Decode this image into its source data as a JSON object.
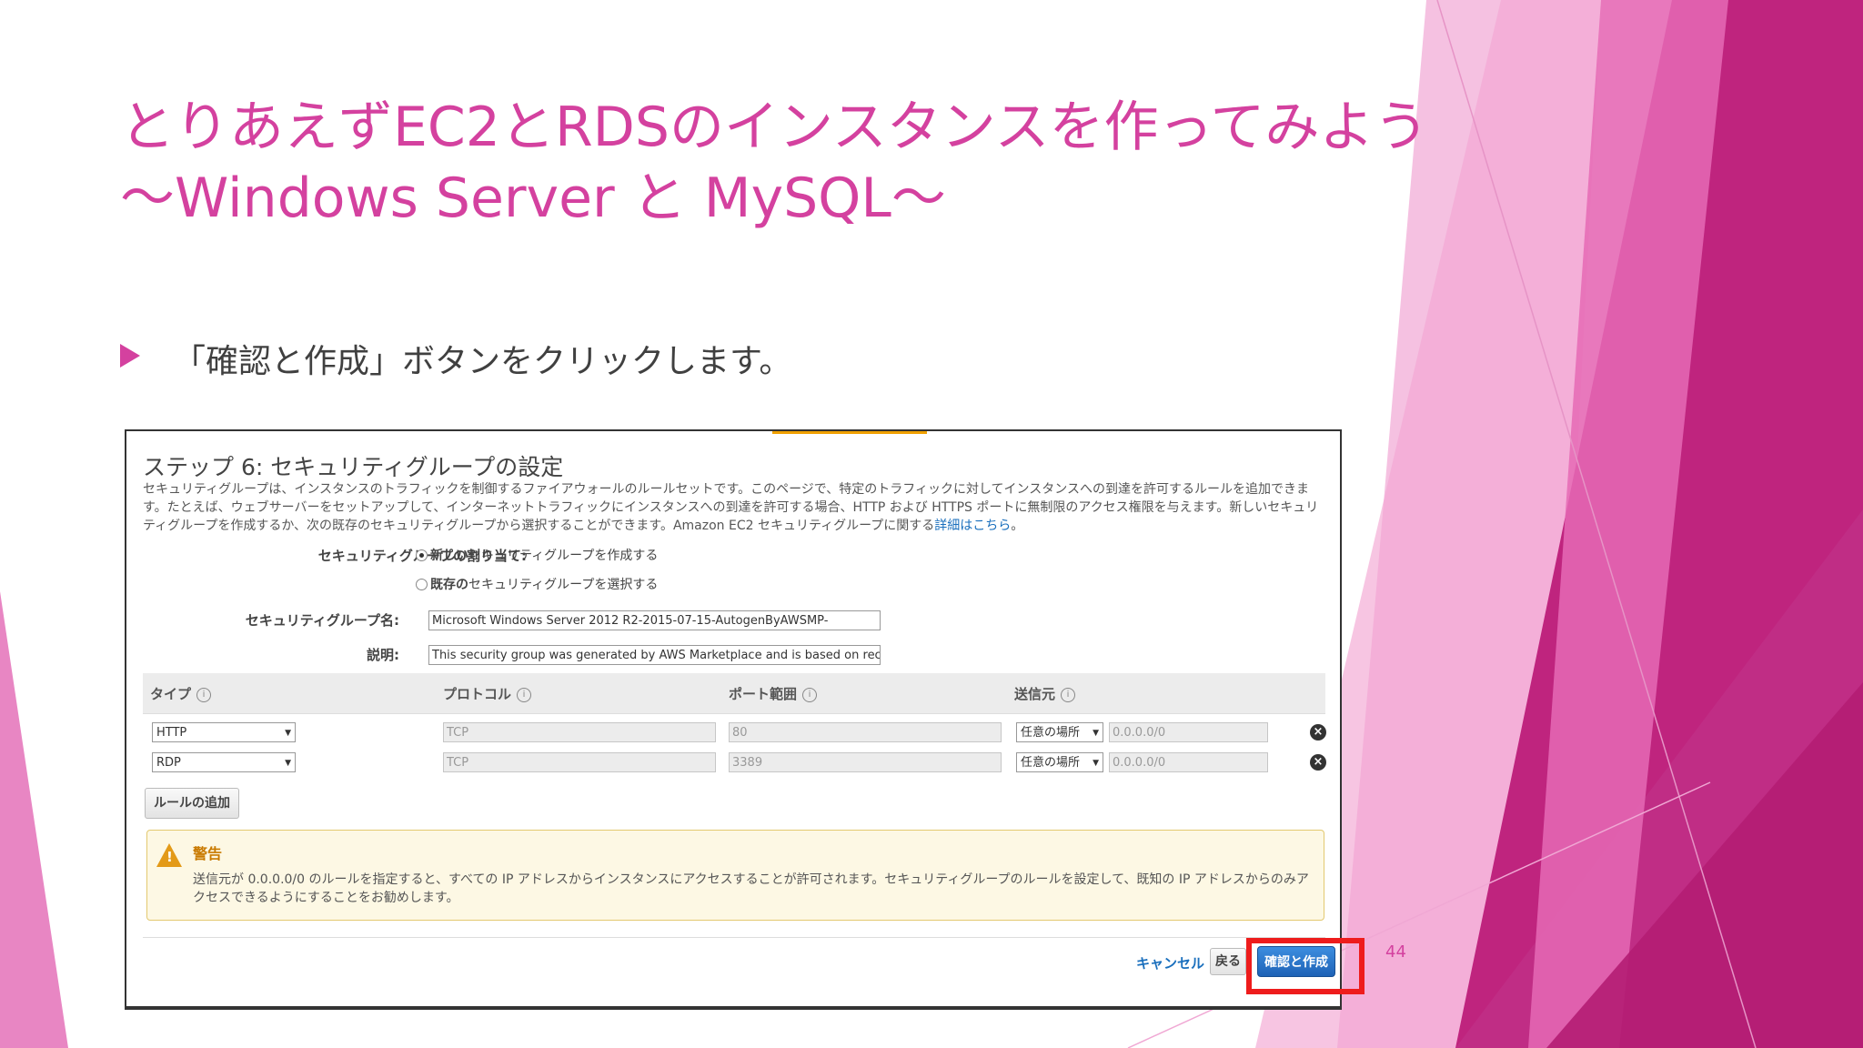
{
  "slide": {
    "title_line1": "とりあえずEC2とRDSのインスタンスを作ってみよう",
    "title_line2": "～Windows Server と MySQL～",
    "bullet_text": "「確認と作成」ボタンをクリックします。",
    "page_number": "44",
    "accent_color": "#d4419f",
    "highlight_color": "#ee1c1c"
  },
  "screenshot": {
    "step_title": "ステップ 6: セキュリティグループの設定",
    "description": "セキュリティグループは、インスタンスのトラフィックを制御するファイアウォールのルールセットです。このページで、特定のトラフィックに対してインスタンスへの到達を許可するルールを追加できます。たとえば、ウェブサーバーをセットアップして、インターネットトラフィックにインスタンスへの到達を許可する場合、HTTP および HTTPS ポートに無制限のアクセス権限を与えます。新しいセキュリティグループを作成するか、次の既存のセキュリティグループから選択することができます。Amazon EC2 セキュリティグループに関する",
    "description_link": "詳細はこちら",
    "description_end": "。",
    "assign_label": "セキュリティグループの割り当て:",
    "radio_new_bold": "新しい",
    "radio_new_rest": "セキュリティグループを作成する",
    "radio_existing_bold": "既存の",
    "radio_existing_rest": "セキュリティグループを選択する",
    "name_label": "セキュリティグループ名:",
    "name_value": "Microsoft Windows Server 2012 R2-2015-07-15-AutogenByAWSMP-",
    "desc_label": "説明:",
    "desc_value": "This security group was generated by AWS Marketplace and is based on recommende",
    "columns": {
      "type": "タイプ",
      "protocol": "プロトコル",
      "port": "ポート範囲",
      "source": "送信元",
      "info_glyph": "i"
    },
    "rules": [
      {
        "type": "HTTP",
        "protocol": "TCP",
        "port": "80",
        "source_sel": "任意の場所",
        "cidr": "0.0.0.0/0"
      },
      {
        "type": "RDP",
        "protocol": "TCP",
        "port": "3389",
        "source_sel": "任意の場所",
        "cidr": "0.0.0.0/0"
      }
    ],
    "add_rule_button": "ルールの追加",
    "warning_title": "警告",
    "warning_text": "送信元が 0.0.0.0/0 のルールを指定すると、すべての IP アドレスからインスタンスにアクセスすることが許可されます。セキュリティグループのルールを設定して、既知の IP アドレスからのみアクセスできるようにすることをお勧めします。",
    "cancel_label": "キャンセル",
    "back_label": "戻る",
    "review_label": "確認と作成",
    "dropdown_glyph": "▼",
    "delete_glyph": "×",
    "warning_glyph": "!"
  }
}
